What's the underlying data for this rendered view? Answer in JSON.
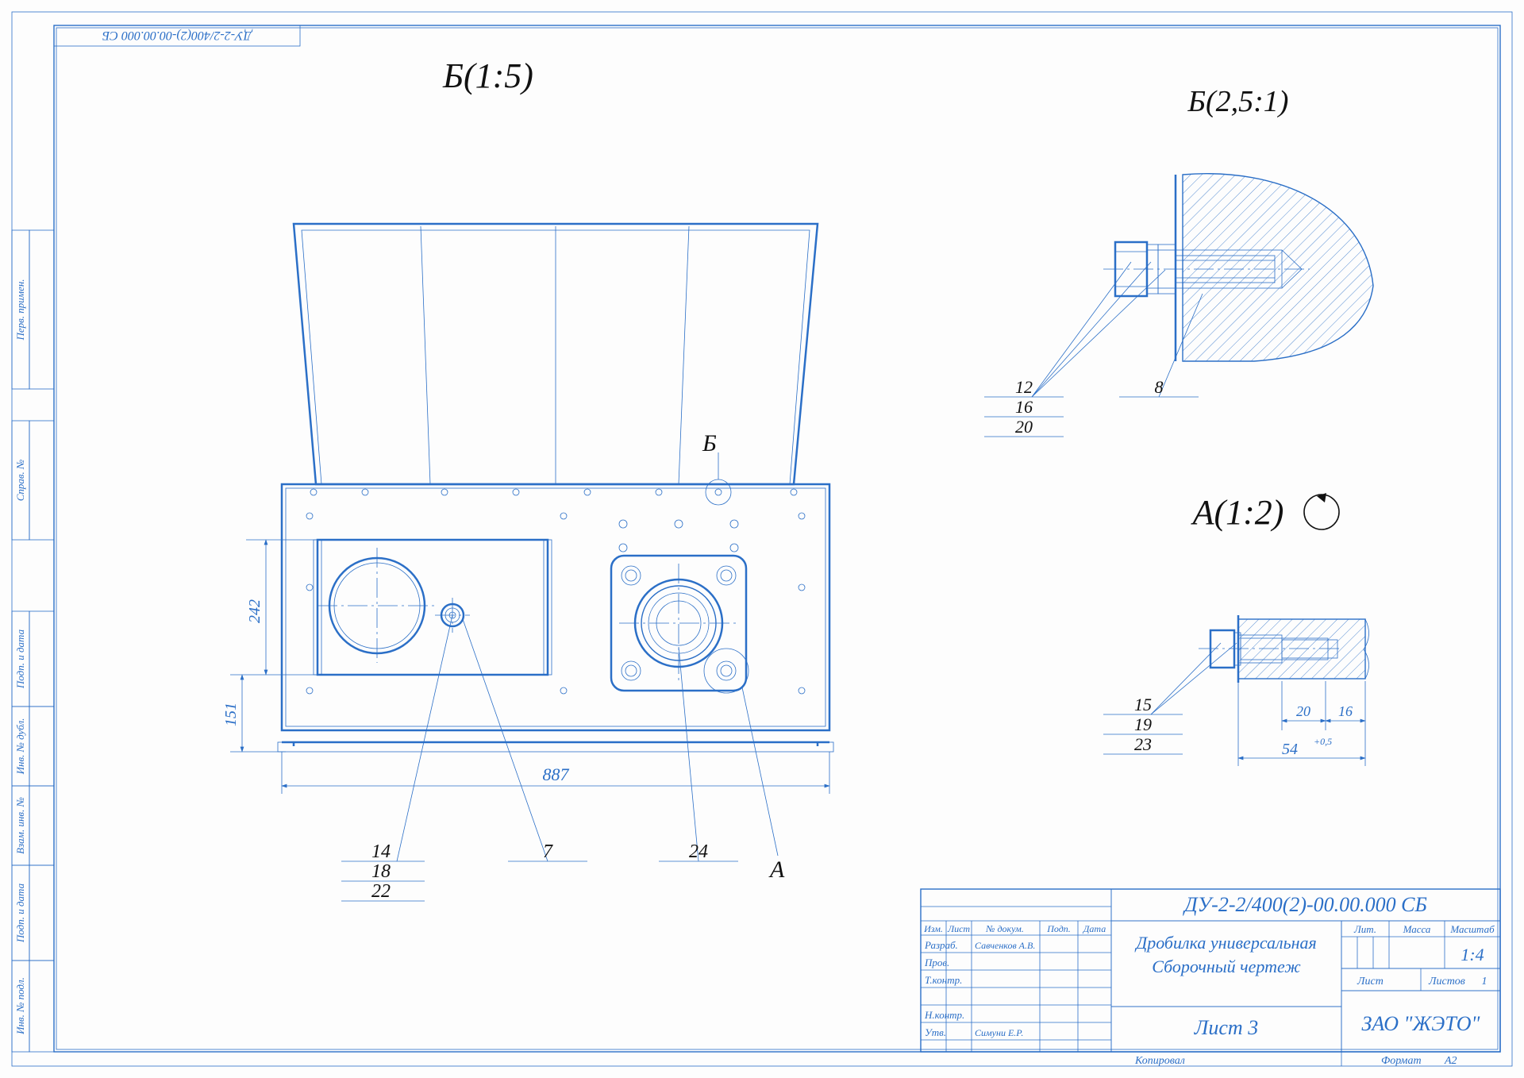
{
  "drawing_code_rotated": "ДУ-2-2/400(2)-00.00.000 СБ",
  "side_boxes": [
    "Перв. примен.",
    "Справ. №",
    "Подп. и дата",
    "Инв. № дубл.",
    "Взам. инв. №",
    "Подп. и дата",
    "Инв. № подл."
  ],
  "views": {
    "main": {
      "title": "Б(1:5)",
      "callouts_left": [
        "14",
        "18",
        "22"
      ],
      "callout_center": "7",
      "callout_right": "24",
      "detail_letter_b": "Б",
      "detail_letter_a": "А",
      "dim_width": "887",
      "dim_h1": "242",
      "dim_h2": "151"
    },
    "detail_b": {
      "title": "Б(2,5:1)",
      "callouts_left": [
        "12",
        "16",
        "20"
      ],
      "callout_right": "8"
    },
    "detail_a": {
      "title": "A(1:2)",
      "callouts_left": [
        "15",
        "19",
        "23"
      ],
      "dim_stack": [
        "20",
        "16"
      ],
      "dim_width": "54",
      "dim_tol": "+0,5"
    }
  },
  "title_block": {
    "code": "ДУ-2-2/400(2)-00.00.000 СБ",
    "name1": "Дробилка универсальная",
    "name2": "Сборочный чертеж",
    "sheet_label": "Лист 3",
    "company": "ЗАО \"ЖЭТО\"",
    "col_headers": [
      "Изм.",
      "Лист",
      "№ докум.",
      "Подп.",
      "Дата"
    ],
    "row_labels": [
      "Разраб.",
      "Пров.",
      "Т.контр.",
      "Н.контр.",
      "Утв."
    ],
    "dev_name": "Савченков А.В.",
    "utv_name": "Симуни Е.Р.",
    "lit": "Лит.",
    "massa": "Масса",
    "masshtab": "Масштаб",
    "scale": "1:4",
    "sheet_small": "Лист",
    "sheets": "Листов",
    "sheets_n": "1",
    "footer_left": "Копировал",
    "footer_right_label": "Формат",
    "format": "А2"
  }
}
